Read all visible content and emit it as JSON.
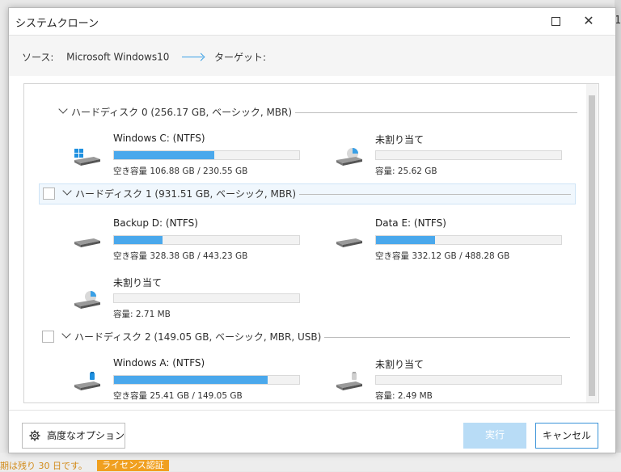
{
  "window": {
    "title": "システムクローン"
  },
  "source_bar": {
    "source_label": "ソース:",
    "source_value": "Microsoft Windows10",
    "target_label": "ターゲット:"
  },
  "disks": [
    {
      "label": "ハードディスク 0 (256.17 GB, ベーシック, MBR)",
      "has_checkbox": false,
      "selected": false,
      "partitions": [
        {
          "name": "Windows C: (NTFS)",
          "info": "空き容量 106.88 GB / 230.55 GB",
          "fill_ratio": 0.54,
          "icon": "windows-drive-icon"
        },
        {
          "name": "未割り当て",
          "info": "容量: 25.62 GB",
          "fill_ratio": 0,
          "icon": "unallocated-pie-icon"
        }
      ]
    },
    {
      "label": "ハードディスク 1 (931.51 GB, ベーシック, MBR)",
      "has_checkbox": true,
      "selected": true,
      "partitions": [
        {
          "name": "Backup D: (NTFS)",
          "info": "空き容量 328.38 GB / 443.23 GB",
          "fill_ratio": 0.26,
          "icon": "hard-drive-icon"
        },
        {
          "name": "Data E: (NTFS)",
          "info": "空き容量 332.12 GB / 488.28 GB",
          "fill_ratio": 0.32,
          "icon": "hard-drive-icon"
        },
        {
          "name": "未割り当て",
          "info": "容量: 2.71 MB",
          "fill_ratio": 0,
          "icon": "unallocated-pie-icon"
        }
      ]
    },
    {
      "label": "ハードディスク 2 (149.05 GB, ベーシック, MBR, USB)",
      "has_checkbox": true,
      "selected": false,
      "partitions": [
        {
          "name": "Windows A: (NTFS)",
          "info": "空き容量 25.41 GB / 149.05 GB",
          "fill_ratio": 0.83,
          "icon": "usb-drive-icon"
        },
        {
          "name": "未割り当て",
          "info": "容量: 2.49 MB",
          "fill_ratio": 0,
          "icon": "usb-drive-icon"
        }
      ]
    }
  ],
  "footer": {
    "advanced_label": "高度なオプション",
    "run_label": "実行",
    "cancel_label": "キャンセル"
  },
  "background": {
    "trial_text": "期は残り 30 日です。",
    "license_text": "ライセンス認証",
    "right_edge_text": "1"
  },
  "colors": {
    "accent": "#4aa8ec",
    "run_disabled": "#b8dcf6",
    "trial_orange": "#f0a020"
  }
}
